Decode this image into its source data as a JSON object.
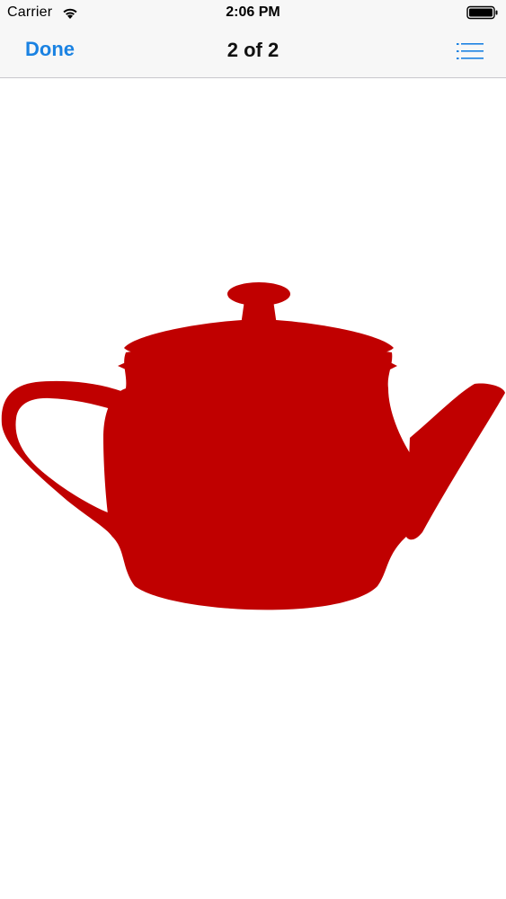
{
  "status_bar": {
    "carrier": "Carrier",
    "time": "2:06 PM",
    "wifi_icon": "wifi-icon",
    "battery_icon": "battery-icon"
  },
  "nav_bar": {
    "done_label": "Done",
    "title": "2 of 2",
    "list_icon": "list-icon",
    "accent_color": "#1a82e2"
  },
  "preview": {
    "image": "teapot-image",
    "fill_color": "#c00000",
    "page_index": 2,
    "page_count": 2
  }
}
